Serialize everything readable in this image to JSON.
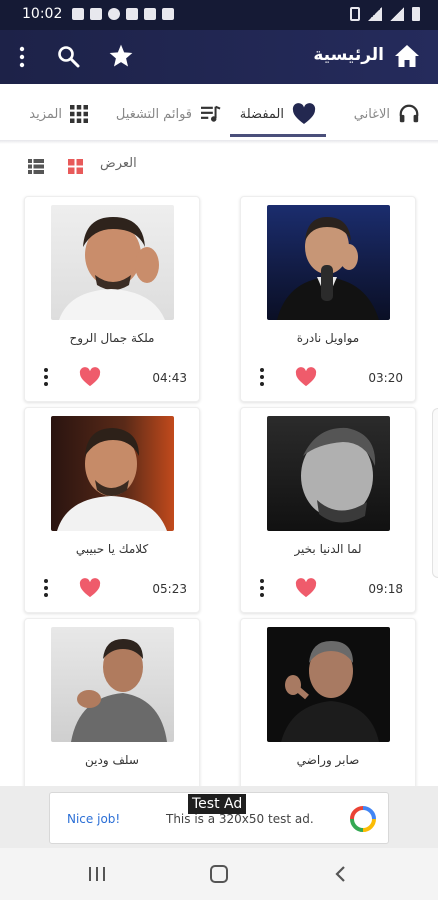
{
  "status_bar": {
    "time": "10:02"
  },
  "app_bar": {
    "title": "الرئيسية",
    "icons": [
      "home-icon",
      "star-icon",
      "search-icon",
      "menu-icon"
    ]
  },
  "tabs": [
    {
      "label": "الاغاني",
      "icon": "headphones-icon",
      "active": false
    },
    {
      "label": "المفضلة",
      "icon": "heart-icon",
      "active": true
    },
    {
      "label": "قوائم التشغيل",
      "icon": "playlist-icon",
      "active": false
    },
    {
      "label": "المزيد",
      "icon": "grid-icon",
      "active": false
    }
  ],
  "view_bar": {
    "label": "العرض"
  },
  "songs": [
    {
      "title": "مواويل نادرة",
      "duration": "03:20"
    },
    {
      "title": "ملكة جمال الروح",
      "duration": "04:43"
    },
    {
      "title": "لما الدنيا بخير",
      "duration": "09:18"
    },
    {
      "title": "كلامك يا حبيبي",
      "duration": "05:23"
    },
    {
      "title": "صابر وراضي",
      "duration": ""
    },
    {
      "title": "سلف ودين",
      "duration": ""
    }
  ],
  "ad": {
    "badge": "Test Ad",
    "lead": "Nice job!",
    "message": "This is a 320x50 test ad."
  },
  "colors": {
    "appbar": "#1d2248",
    "heart": "#ef5b6b",
    "tab_indicator": "#4a4f7a",
    "grid_view_active": "#e85a5a",
    "ad_link": "#2b6fd6"
  }
}
